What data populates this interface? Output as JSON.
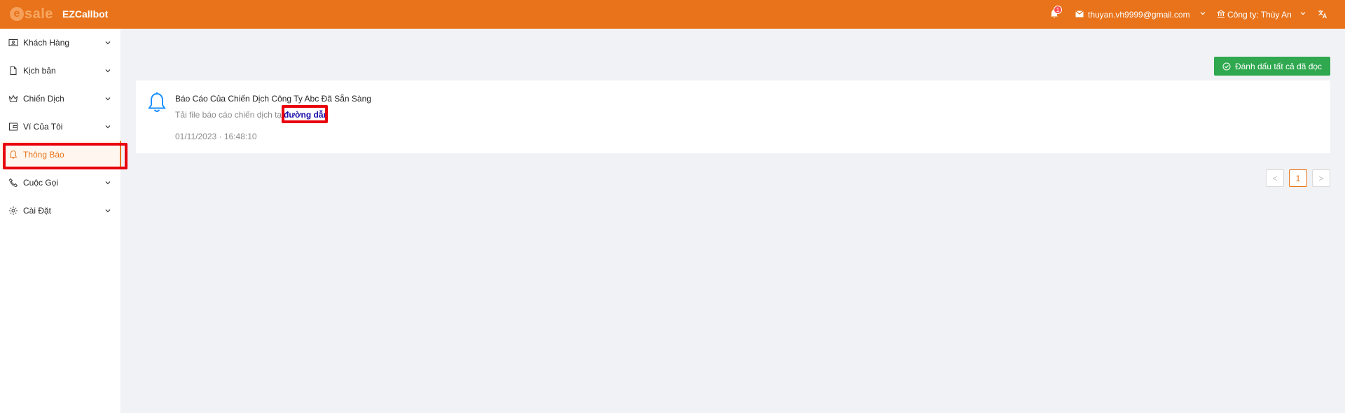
{
  "header": {
    "logo_text": "sale",
    "logo_mark": "e",
    "app_name": "EZCallbot",
    "notification_count": "1",
    "email": "thuyan.vh9999@gmail.com",
    "company": "Công ty: Thùy An"
  },
  "sidebar": {
    "items": [
      {
        "label": "Khách Hàng",
        "icon": "contact-card-icon"
      },
      {
        "label": "Kịch bản",
        "icon": "file-icon"
      },
      {
        "label": "Chiến Dịch",
        "icon": "crown-icon"
      },
      {
        "label": "Ví Của Tôi",
        "icon": "wallet-icon"
      },
      {
        "label": "Thông Báo",
        "icon": "bell-icon"
      },
      {
        "label": "Cuộc Gọi",
        "icon": "phone-icon"
      },
      {
        "label": "Cài Đặt",
        "icon": "gear-icon"
      }
    ],
    "active_index": 4
  },
  "main": {
    "mark_all_read_label": "Đánh dấu tất cả đã đọc",
    "notification": {
      "title": "Báo Cáo Của Chiến Dịch Công Ty Abc Đã Sẵn Sàng",
      "description": "Tải file báo cáo chiến dịch tại",
      "link_text": "đường dẫn",
      "timestamp": "01/11/2023 · 16:48:10"
    },
    "pagination": {
      "current_page": "1",
      "prev": "<",
      "next": ">"
    }
  },
  "colors": {
    "brand": "#e8731a",
    "success": "#2fa84f",
    "highlight": "#e8000b",
    "link": "#1a0dab"
  }
}
